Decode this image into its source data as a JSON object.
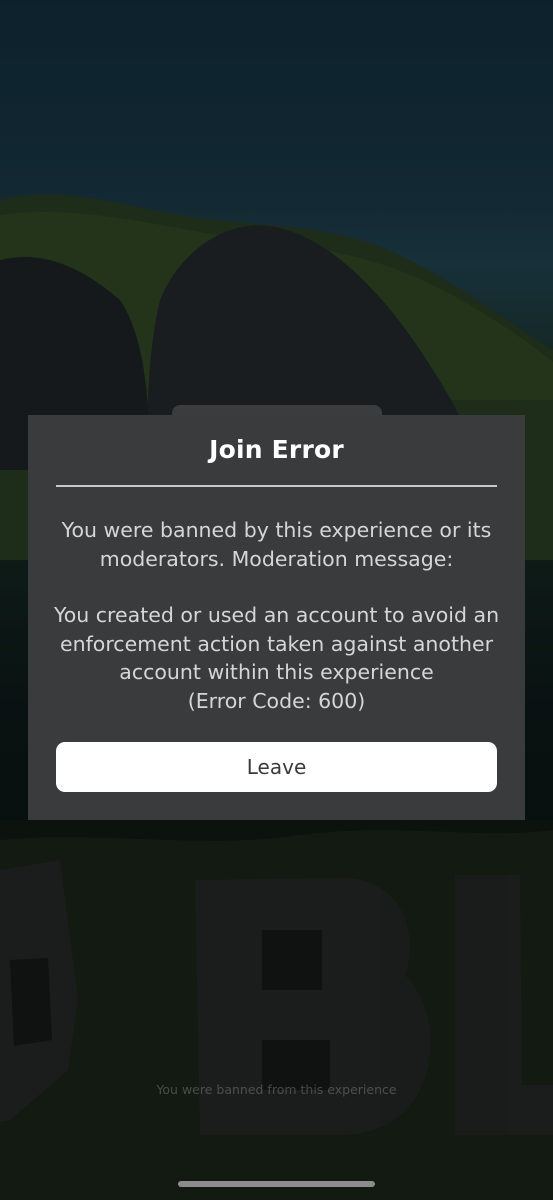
{
  "dialog": {
    "title": "Join Error",
    "message_line1": "You were banned by this experience or its moderators. Moderation message:",
    "message_line2": "You created or used an account to avoid an enforcement action taken against another account within this experience",
    "error_code": "(Error Code: 600)",
    "leave_label": "Leave"
  },
  "background": {
    "footer_text": "You were banned from this experience"
  },
  "colors": {
    "dialog_bg": "#393b3d",
    "title_text": "#ffffff",
    "body_text": "#d6d6d6",
    "button_bg": "#ffffff"
  }
}
